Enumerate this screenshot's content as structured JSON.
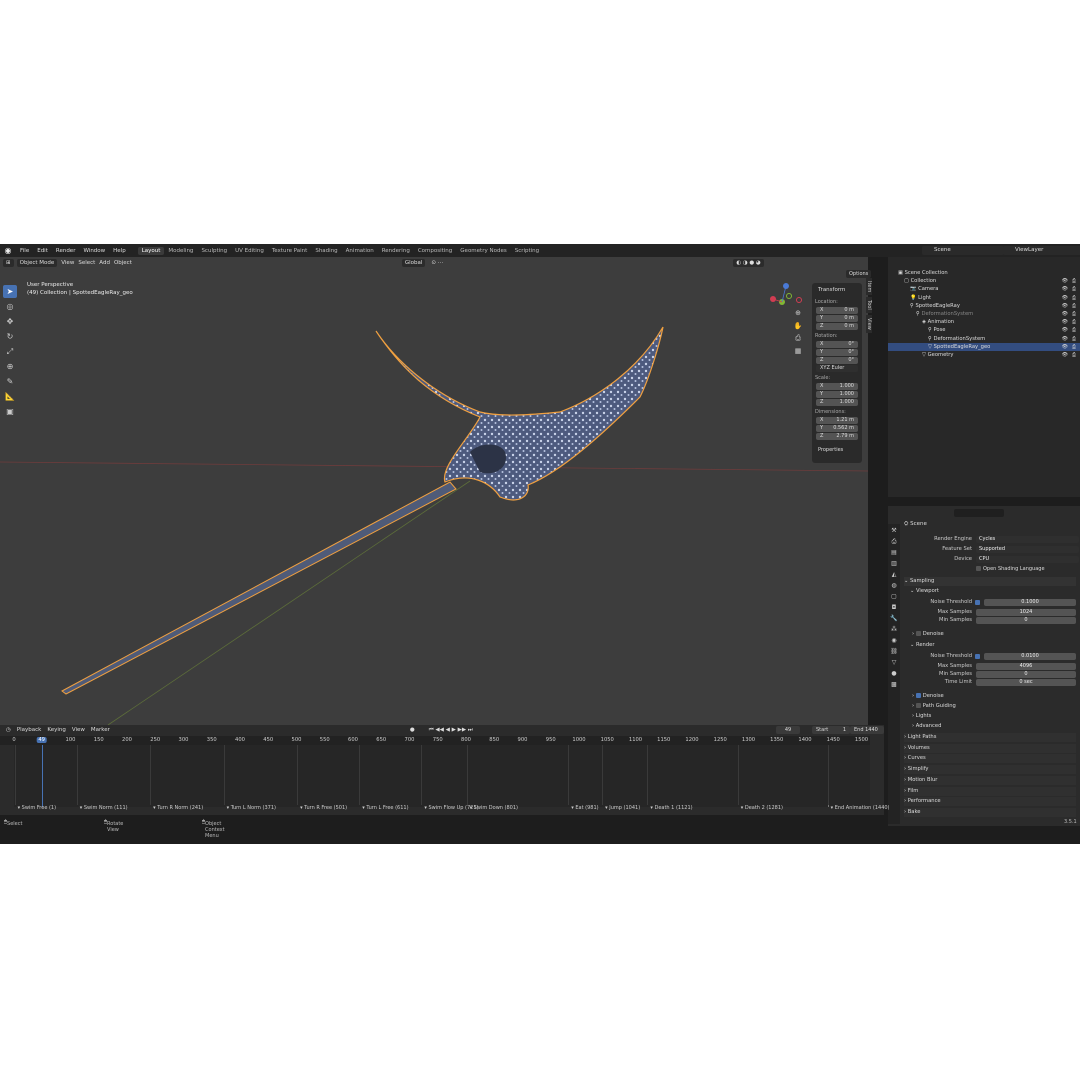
{
  "app": {
    "menu": [
      "File",
      "Edit",
      "Render",
      "Window",
      "Help"
    ],
    "workspaces": [
      "Layout",
      "Modeling",
      "Sculpting",
      "UV Editing",
      "Texture Paint",
      "Shading",
      "Animation",
      "Rendering",
      "Compositing",
      "Geometry Nodes",
      "Scripting"
    ],
    "active_workspace": "Layout",
    "scene": "Scene",
    "view_layer": "ViewLayer"
  },
  "viewport": {
    "mode": "Object Mode",
    "menus": [
      "View",
      "Select",
      "Add",
      "Object"
    ],
    "orientation": "Global",
    "options_label": "Options",
    "info_line1": "User Perspective",
    "info_line2": "(49) Collection | SpottedEagleRay_geo"
  },
  "npanel": {
    "title": "Transform",
    "location_label": "Location:",
    "location": [
      {
        "ax": "X",
        "v": "0 m"
      },
      {
        "ax": "Y",
        "v": "0 m"
      },
      {
        "ax": "Z",
        "v": "0 m"
      }
    ],
    "rotation_label": "Rotation:",
    "rotation": [
      {
        "ax": "X",
        "v": "0°"
      },
      {
        "ax": "Y",
        "v": "0°"
      },
      {
        "ax": "Z",
        "v": "0°"
      }
    ],
    "rotation_mode": "XYZ Euler",
    "scale_label": "Scale:",
    "scale": [
      {
        "ax": "X",
        "v": "1.000"
      },
      {
        "ax": "Y",
        "v": "1.000"
      },
      {
        "ax": "Z",
        "v": "1.000"
      }
    ],
    "dimensions_label": "Dimensions:",
    "dimensions": [
      {
        "ax": "X",
        "v": "1.21 m"
      },
      {
        "ax": "Y",
        "v": "0.562 m"
      },
      {
        "ax": "Z",
        "v": "2.79 m"
      }
    ],
    "properties_label": "Properties",
    "tabs": [
      "Item",
      "Tool",
      "View"
    ]
  },
  "outliner": {
    "rows": [
      {
        "label": "Scene Collection"
      },
      {
        "label": "Collection"
      },
      {
        "label": "Camera"
      },
      {
        "label": "Light"
      },
      {
        "label": "SpottedEagleRay"
      },
      {
        "label": "DeformationSystem"
      },
      {
        "label": "Animation"
      },
      {
        "label": "Pose"
      },
      {
        "label": "DeformationSystem"
      },
      {
        "label": "SpottedEagleRay_geo"
      },
      {
        "label": "Geometry"
      }
    ]
  },
  "properties": {
    "title": "Scene",
    "render_engine_label": "Render Engine",
    "render_engine": "Cycles",
    "feature_set_label": "Feature Set",
    "feature_set": "Supported",
    "device_label": "Device",
    "device": "CPU",
    "osl_label": "Open Shading Language",
    "sampling": "Sampling",
    "viewport": "Viewport",
    "noise_threshold_label": "Noise Threshold",
    "vp_noise": "0.1000",
    "max_samples_label": "Max Samples",
    "vp_max": "1024",
    "min_samples_label": "Min Samples",
    "vp_min": "0",
    "denoise": "Denoise",
    "render": "Render",
    "r_noise": "0.0100",
    "r_max": "4096",
    "r_min": "0",
    "time_limit_label": "Time Limit",
    "r_time": "0 sec",
    "path_guiding": "Path Guiding",
    "lights": "Lights",
    "advanced": "Advanced",
    "sections": [
      "Light Paths",
      "Volumes",
      "Curves",
      "Simplify",
      "Motion Blur",
      "Film",
      "Performance",
      "Bake"
    ]
  },
  "timeline": {
    "menus": [
      "Playback",
      "Keying",
      "View",
      "Marker"
    ],
    "current_frame": "49",
    "start_label": "Start",
    "start": "1",
    "end_label": "End",
    "end": "1440",
    "ticks": [
      "0",
      "49",
      "100",
      "150",
      "200",
      "250",
      "300",
      "350",
      "400",
      "450",
      "500",
      "550",
      "600",
      "650",
      "700",
      "750",
      "800",
      "850",
      "900",
      "950",
      "1000",
      "1050",
      "1100",
      "1150",
      "1200",
      "1250",
      "1300",
      "1350",
      "1400",
      "1450",
      "1500"
    ],
    "markers": [
      {
        "label": "Swim Free (1)"
      },
      {
        "label": "Swim Norm (111)"
      },
      {
        "label": "Turn R Norm (241)"
      },
      {
        "label": "Turn L Norm (371)"
      },
      {
        "label": "Turn R Free (501)"
      },
      {
        "label": "Turn L Free (611)"
      },
      {
        "label": "Swim Flow Up (721)"
      },
      {
        "label": "Swim Down (801)"
      },
      {
        "label": "Eat (981)"
      },
      {
        "label": "Jump (1041)"
      },
      {
        "label": "Death 1 (1121)"
      },
      {
        "label": "Death 2 (1281)"
      },
      {
        "label": "End Animation (1440)"
      }
    ]
  },
  "status": {
    "select": "Select",
    "rotate": "Rotate View",
    "context": "Object Context Menu",
    "version": "3.5.1"
  }
}
